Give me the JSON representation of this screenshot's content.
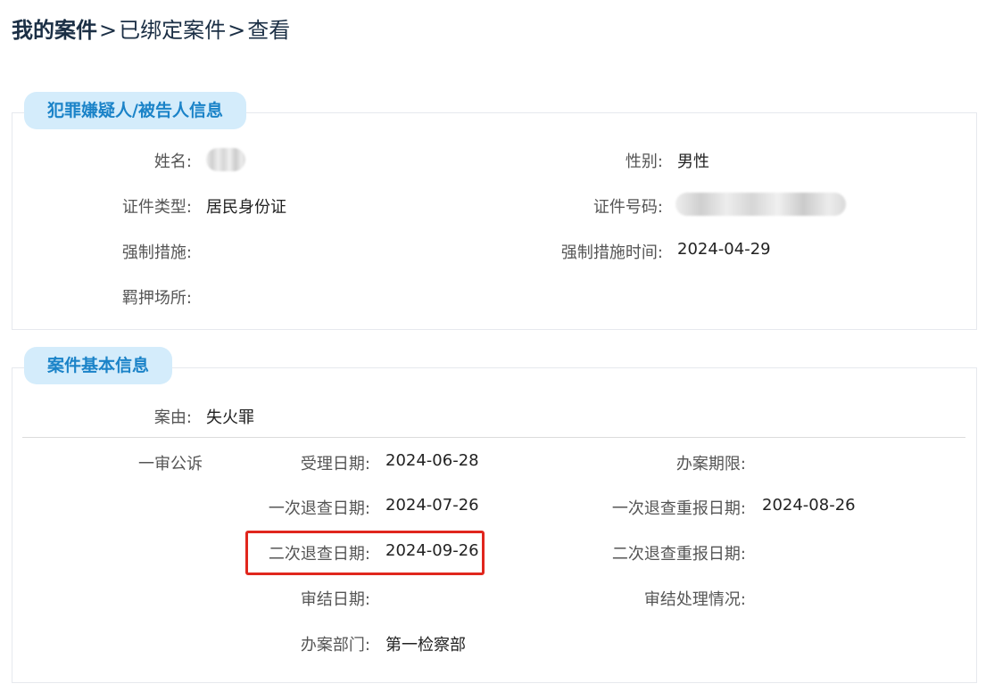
{
  "breadcrumb": {
    "root": "我的案件",
    "sep1": ">",
    "middle": "已绑定案件",
    "sep2": ">",
    "current": "查看"
  },
  "suspect_panel": {
    "title": "犯罪嫌疑人/被告人信息",
    "name_label": "姓名:",
    "gender_label": "性别:",
    "gender_value": "男性",
    "id_type_label": "证件类型:",
    "id_type_value": "居民身份证",
    "id_number_label": "证件号码:",
    "measure_label": "强制措施:",
    "measure_time_label": "强制措施时间:",
    "measure_time_value": "2024-04-29",
    "detention_label": "羁押场所:"
  },
  "case_panel": {
    "title": "案件基本信息",
    "cause_label": "案由:",
    "cause_value": "失火罪",
    "stage": "一审公诉",
    "accept_date_label": "受理日期:",
    "accept_date_value": "2024-06-28",
    "deadline_label": "办案期限:",
    "first_return_label": "一次退查日期:",
    "first_return_value": "2024-07-26",
    "first_resubmit_label": "一次退查重报日期:",
    "first_resubmit_value": "2024-08-26",
    "second_return_label": "二次退查日期:",
    "second_return_value": "2024-09-26",
    "second_resubmit_label": "二次退查重报日期:",
    "closing_date_label": "审结日期:",
    "closing_status_label": "审结处理情况:",
    "department_label": "办案部门:",
    "department_value": "第一检察部"
  },
  "colors": {
    "tab_bg": "#d4ecfb",
    "tab_text": "#1b83c8",
    "highlight": "#e0261d"
  }
}
